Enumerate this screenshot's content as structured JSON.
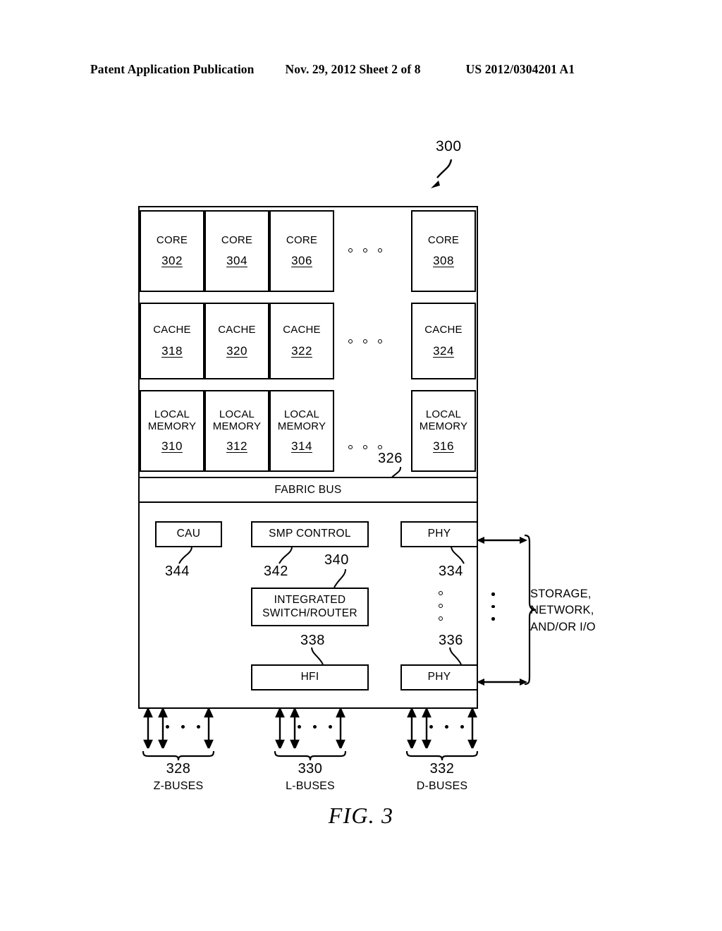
{
  "header": {
    "left": "Patent Application Publication",
    "middle": "Nov. 29, 2012  Sheet 2 of 8",
    "right": "US 2012/0304201 A1"
  },
  "figure": {
    "caption": "FIG. 3",
    "diagram_ref": "300"
  },
  "chip": {
    "cores": [
      {
        "name": "CORE",
        "num": "302"
      },
      {
        "name": "CORE",
        "num": "304"
      },
      {
        "name": "CORE",
        "num": "306"
      },
      {
        "name": "CORE",
        "num": "308"
      }
    ],
    "caches": [
      {
        "name": "CACHE",
        "num": "318"
      },
      {
        "name": "CACHE",
        "num": "320"
      },
      {
        "name": "CACHE",
        "num": "322"
      },
      {
        "name": "CACHE",
        "num": "324"
      }
    ],
    "local_memories": [
      {
        "name": "LOCAL\nMEMORY",
        "num": "310"
      },
      {
        "name": "LOCAL\nMEMORY",
        "num": "312"
      },
      {
        "name": "LOCAL\nMEMORY",
        "num": "314"
      },
      {
        "name": "LOCAL\nMEMORY",
        "num": "316"
      }
    ],
    "fabric_bus": {
      "label": "FABRIC BUS",
      "num": "326"
    },
    "logic_blocks": {
      "cau": {
        "label": "CAU",
        "num": "344"
      },
      "smp_control": {
        "label": "SMP CONTROL",
        "num": "342"
      },
      "integrated_switch_router": {
        "label": "INTEGRATED\nSWITCH/ROUTER",
        "num": "340"
      },
      "hfi": {
        "label": "HFI",
        "num": "338"
      },
      "phy_top": {
        "label": "PHY",
        "num": "334"
      },
      "phy_bottom": {
        "label": "PHY",
        "num": "336"
      }
    }
  },
  "io": {
    "caption": "STORAGE,\nNETWORK,\nAND/OR I/O"
  },
  "buses": [
    {
      "num": "328",
      "label": "Z-BUSES"
    },
    {
      "num": "330",
      "label": "L-BUSES"
    },
    {
      "num": "332",
      "label": "D-BUSES"
    }
  ]
}
